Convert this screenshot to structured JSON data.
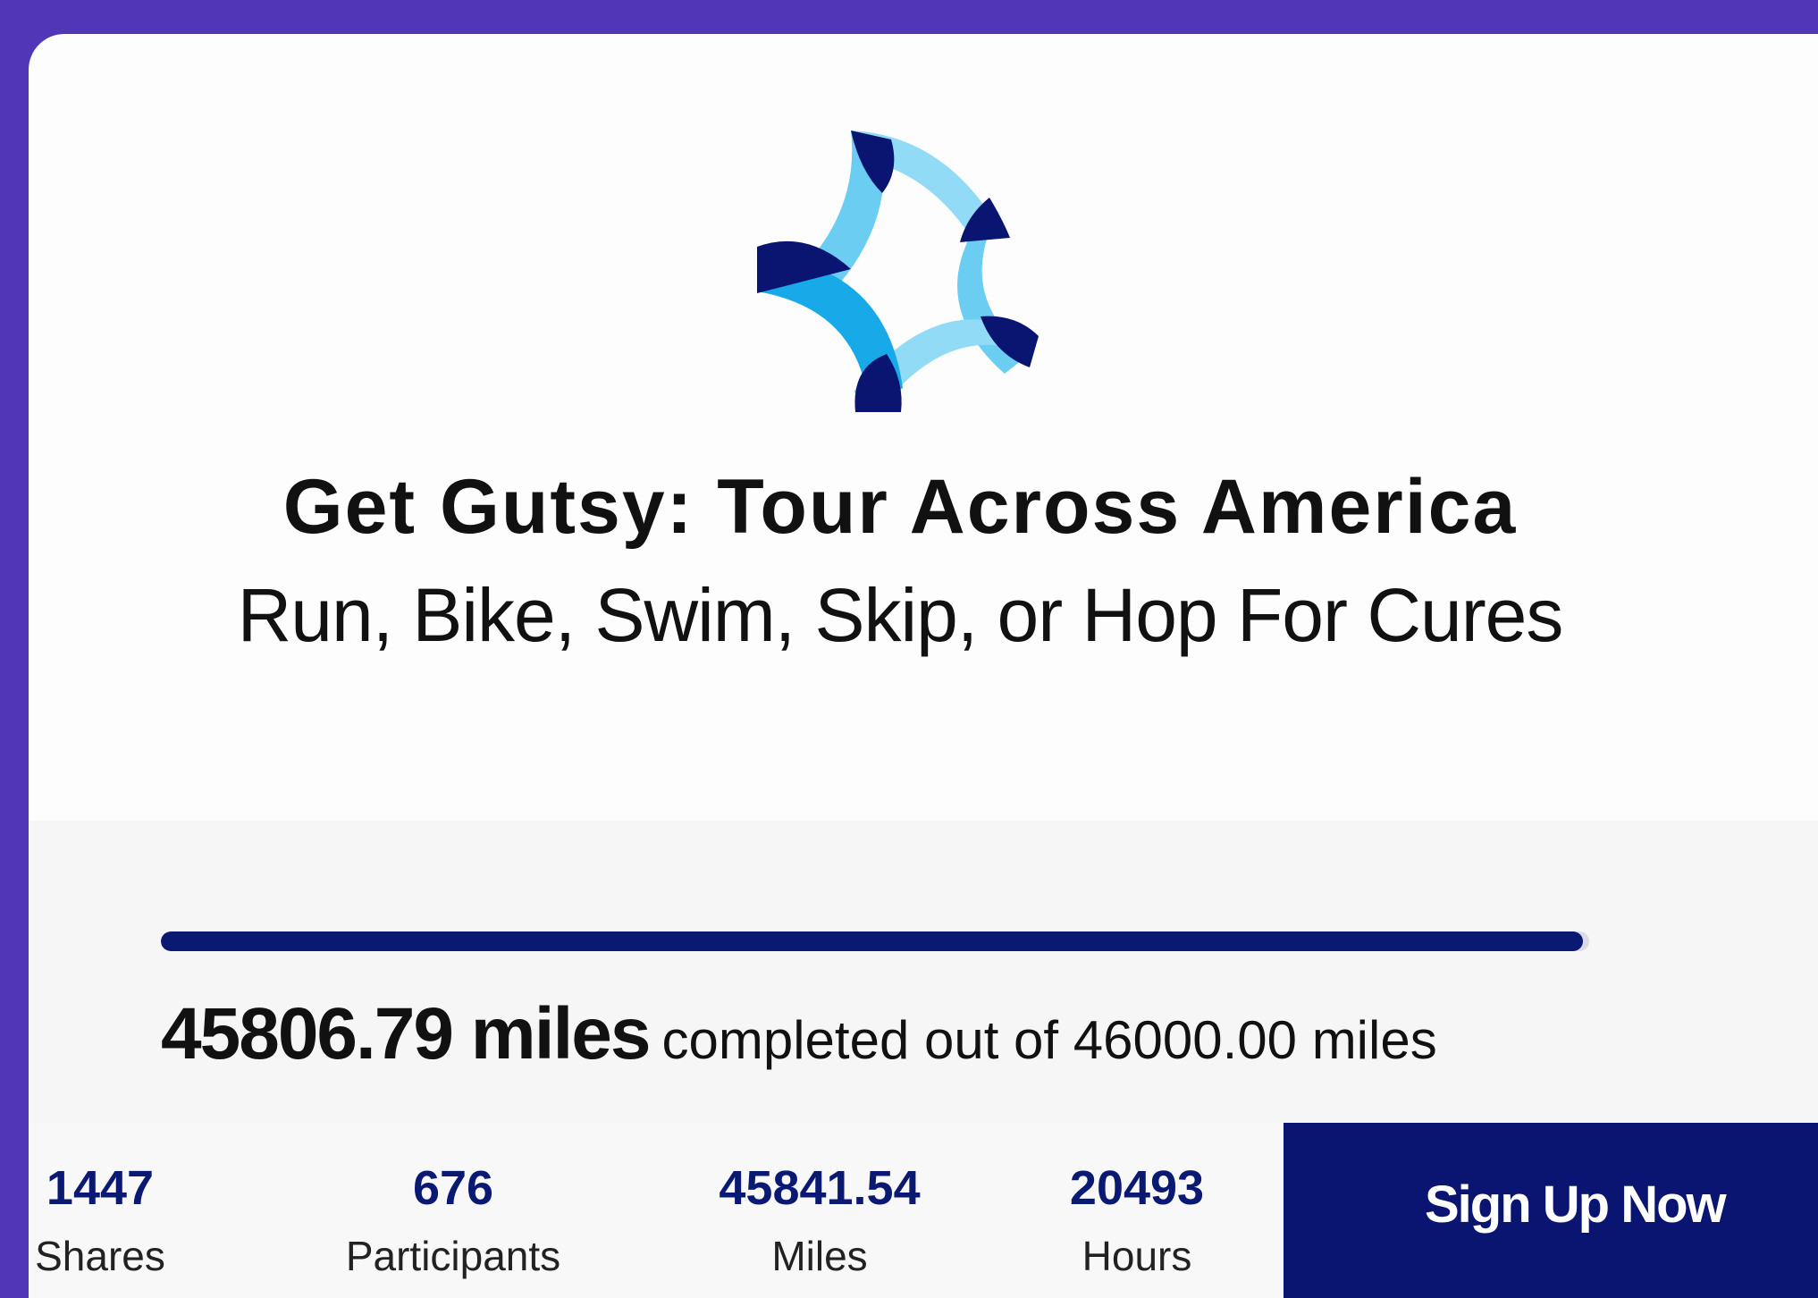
{
  "campaign": {
    "title": "Get Gutsy: Tour Across America",
    "subtitle": "Run, Bike, Swim, Skip, or Hop For Cures",
    "logo_icon": "swirl-star-logo-icon"
  },
  "progress": {
    "completed_text": "45806.79 miles",
    "goal_text": "completed out of 46000.00 miles",
    "completed": 45806.79,
    "goal": 46000.0
  },
  "stats": [
    {
      "value": "1447",
      "label": "Shares"
    },
    {
      "value": "676",
      "label": "Participants"
    },
    {
      "value": "45841.54",
      "label": "Miles"
    },
    {
      "value": "20493",
      "label": "Hours"
    }
  ],
  "signup": {
    "label": "Sign Up Now"
  },
  "colors": {
    "page_bg": "#5236b8",
    "navy": "#0a1572",
    "light_blue": "#6ccdf3",
    "mid_blue": "#17a9e8",
    "pale_blue": "#92dbf6"
  }
}
